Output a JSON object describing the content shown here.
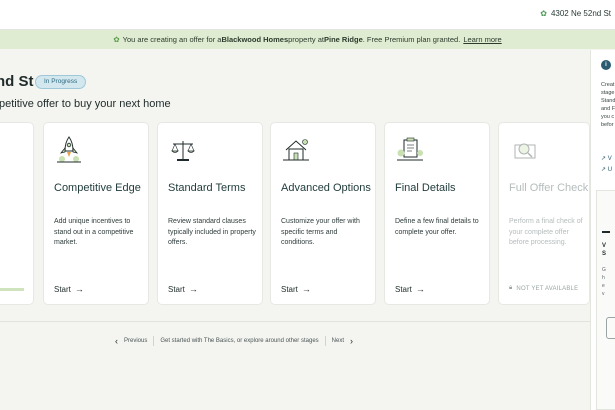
{
  "header": {
    "address": "4302 Ne 52nd St",
    "address_icon": "leaf-icon"
  },
  "banner": {
    "prefix": "You are creating an offer for a ",
    "brand": "Blackwood Homes",
    "middle": " property at ",
    "community": "Pine Ridge",
    "suffix": ". Free Premium plan granted.",
    "link": "Learn more"
  },
  "page": {
    "title": "nd St",
    "status": "In Progress",
    "subtitle": "petitive offer to buy your next home"
  },
  "partial_card": {
    "lines": [
      "...",
      "g",
      "nd"
    ]
  },
  "cards": [
    {
      "title": "Competitive Edge",
      "desc": "Add unique incentives to stand out in a competitive market.",
      "action": "Start",
      "icon": "rocket-icon"
    },
    {
      "title": "Standard Terms",
      "desc": "Review standard clauses typically included in property offers.",
      "action": "Start",
      "icon": "scales-icon"
    },
    {
      "title": "Advanced Options",
      "desc": "Customize your offer with specific terms and conditions.",
      "action": "Start",
      "icon": "house-tools-icon"
    },
    {
      "title": "Final Details",
      "desc": "Define a few final details to complete your offer.",
      "action": "Start",
      "icon": "clipboard-icon"
    },
    {
      "title": "Full Offer Check",
      "desc": "Perform a final check of your complete offer before processing.",
      "lock_label": "NOT YET AVAILABLE",
      "icon": "magnifier-icon"
    }
  ],
  "pager": {
    "previous": "Previous",
    "message": "Get started with The Basics, or explore around other stages",
    "next": "Next"
  },
  "right_panel": {
    "text_lines": [
      "Creat",
      "stage",
      "Stand",
      "and F",
      "you c",
      "befor"
    ],
    "links": [
      "V",
      "U"
    ],
    "box_title_lines": [
      "V",
      "S"
    ],
    "box_desc_lines": [
      "G",
      "h",
      "e",
      "v"
    ]
  },
  "colors": {
    "accent": "#2a5a70",
    "banner_bg": "#dfecd2",
    "badge_bg": "#d3e7ef"
  }
}
